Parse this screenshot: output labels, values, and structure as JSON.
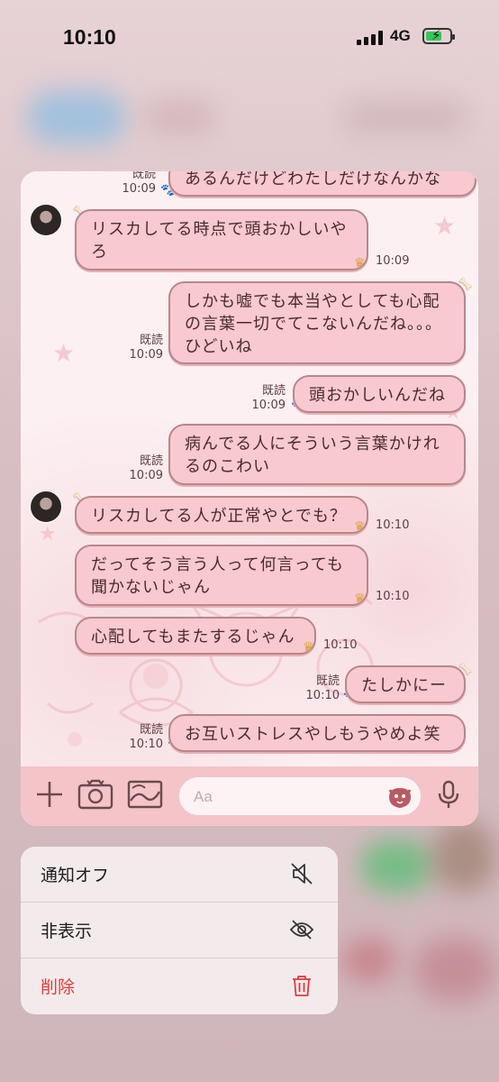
{
  "status_bar": {
    "time": "10:10",
    "network": "4G"
  },
  "chat": {
    "messages": [
      {
        "id": "m0",
        "side": "right",
        "text": "あるんだけどわたしだけなんかな",
        "read": "既読",
        "time": "10:09"
      },
      {
        "id": "m1",
        "side": "left",
        "text": "リスカしてる時点で頭おかしいやろ",
        "time": "10:09"
      },
      {
        "id": "m2",
        "side": "right",
        "text": "しかも嘘でも本当やとしても心配の言葉一切でてこないんだね。。。ひどいね",
        "read": "既読",
        "time": "10:09"
      },
      {
        "id": "m3",
        "side": "right",
        "text": "頭おかしいんだね",
        "read": "既読",
        "time": "10:09"
      },
      {
        "id": "m4",
        "side": "right",
        "text": "病んでる人にそういう言葉かけれるのこわい",
        "read": "既読",
        "time": "10:09"
      },
      {
        "id": "m5",
        "side": "left",
        "text": "リスカしてる人が正常やとでも？",
        "time": "10:10"
      },
      {
        "id": "m6",
        "side": "left",
        "text": "だってそう言う人って何言っても聞かないじゃん",
        "time": "10:10"
      },
      {
        "id": "m7",
        "side": "left",
        "text": "心配してもまたするじゃん",
        "time": "10:10"
      },
      {
        "id": "m8",
        "side": "right",
        "text": "たしかにー",
        "read": "既読",
        "time": "10:10"
      },
      {
        "id": "m9",
        "side": "right",
        "text": "お互いストレスやしもうやめよ笑",
        "read": "既読",
        "time": "10:10"
      }
    ],
    "input_placeholder": "Aa"
  },
  "context_menu": {
    "items": [
      {
        "label": "通知オフ",
        "icon": "mute-icon"
      },
      {
        "label": "非表示",
        "icon": "eye-slash-icon"
      },
      {
        "label": "削除",
        "icon": "trash-icon",
        "color": "#e23b3b"
      }
    ]
  },
  "colors": {
    "bubble": "#f8c9ce",
    "bubble_border": "#b7868c",
    "input_bar": "#f4c4c9",
    "danger": "#e23b3b"
  }
}
